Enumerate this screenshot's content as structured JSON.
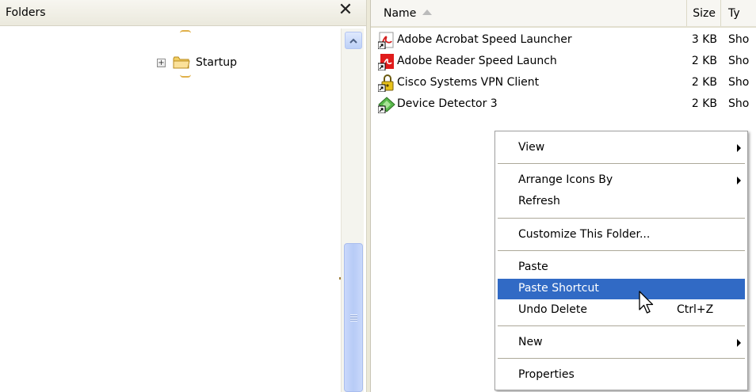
{
  "folders_pane": {
    "title": "Folders",
    "close_glyph": "✕",
    "tree_item": {
      "expander": "+",
      "label": "Startup",
      "icon": "folder-icon"
    },
    "scroll_up_icon": "scroll-up-arrow-icon"
  },
  "file_list": {
    "columns": {
      "name": "Name",
      "size": "Size",
      "type": "Ty"
    },
    "rows": [
      {
        "name": "Adobe Acrobat Speed Launcher",
        "size": "3 KB",
        "type": "Sho",
        "icon": "acrobat-shortcut-icon"
      },
      {
        "name": "Adobe Reader Speed Launch",
        "size": "2 KB",
        "type": "Sho",
        "icon": "reader-shortcut-icon"
      },
      {
        "name": "Cisco Systems VPN Client",
        "size": "2 KB",
        "type": "Sho",
        "icon": "vpn-lock-shortcut-icon"
      },
      {
        "name": "Device Detector 3",
        "size": "2 KB",
        "type": "Sho",
        "icon": "device-detector-shortcut-icon"
      }
    ]
  },
  "context_menu": {
    "view": "View",
    "arrange_icons_by": "Arrange Icons By",
    "refresh": "Refresh",
    "customize": "Customize This Folder...",
    "paste": "Paste",
    "paste_shortcut": "Paste Shortcut",
    "undo_delete": "Undo Delete",
    "undo_delete_shortcut": "Ctrl+Z",
    "new": "New",
    "properties": "Properties",
    "highlighted_item": "Paste Shortcut"
  },
  "colors": {
    "menu_highlight": "#316ac5",
    "scrollbar_blue": "#c1d3fb",
    "header_bg": "#f7f6f2"
  }
}
